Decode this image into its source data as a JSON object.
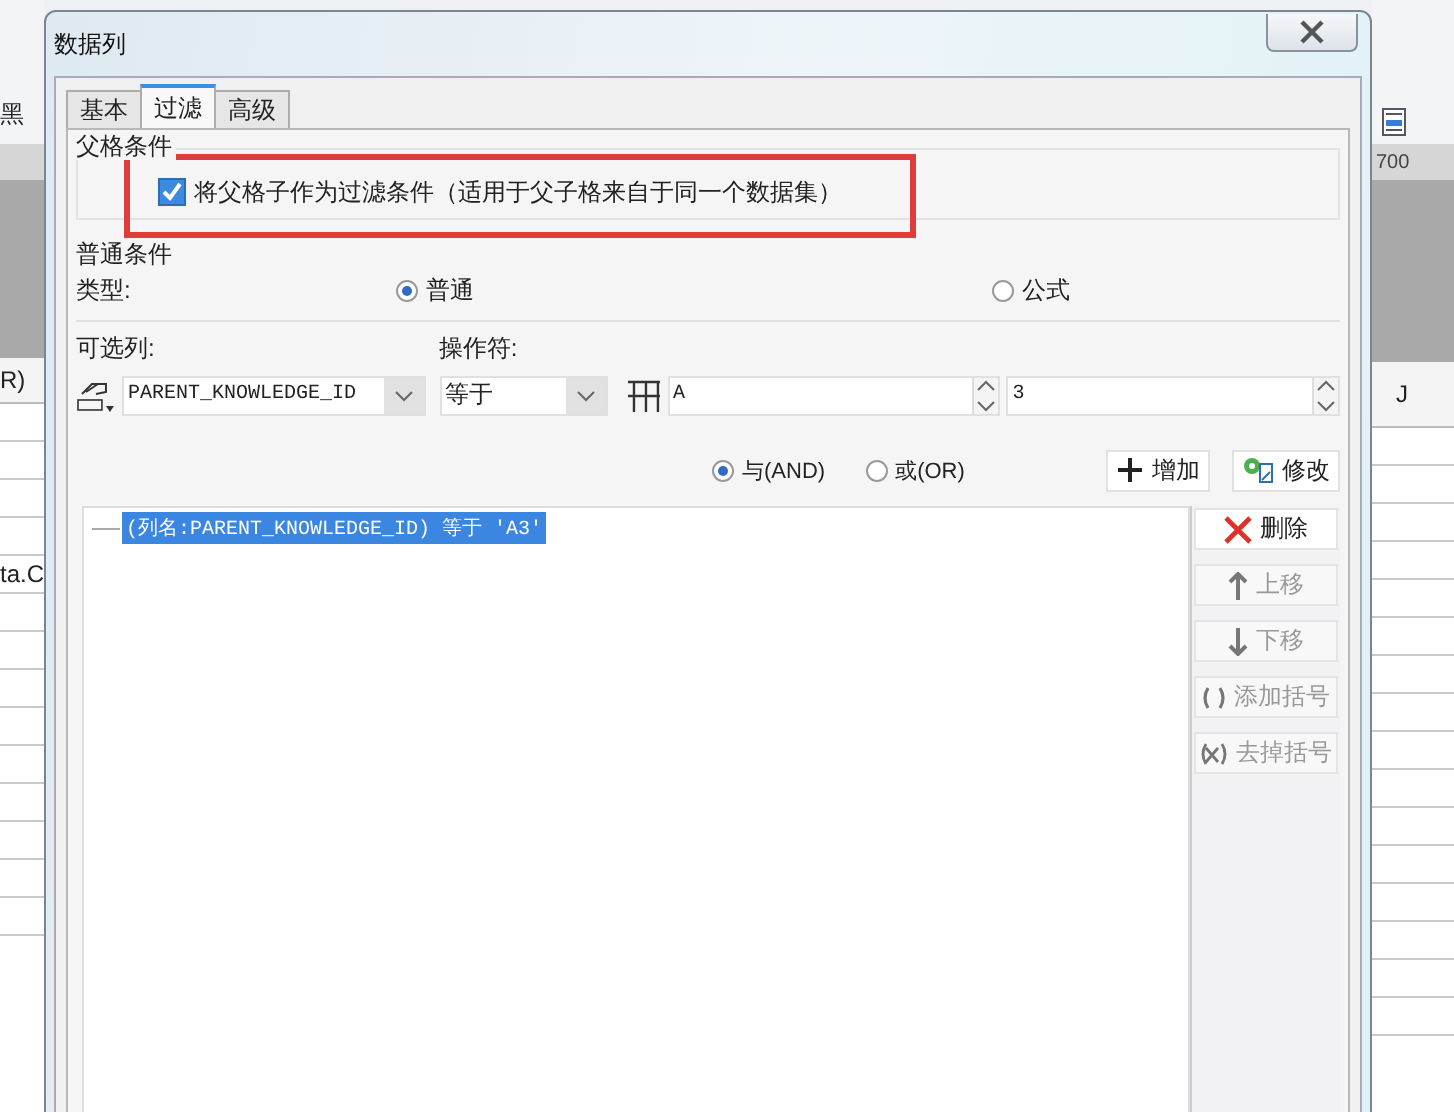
{
  "background": {
    "left_texts": [
      "黑",
      "R)",
      "ta.C"
    ],
    "right_texts": [
      "700",
      "J"
    ]
  },
  "dialog": {
    "title": "数据列"
  },
  "tabs": [
    {
      "label": "基本",
      "selected": false
    },
    {
      "label": "过滤",
      "selected": true
    },
    {
      "label": "高级",
      "selected": false
    }
  ],
  "parent_condition": {
    "label": "父格条件",
    "checkbox": {
      "label": "将父格子作为过滤条件（适用于父子格来自于同一个数据集）",
      "checked": true
    }
  },
  "normal_condition": {
    "label": "普通条件",
    "type_label": "类型:",
    "type_options": [
      {
        "label": "普通",
        "selected": true
      },
      {
        "label": "公式",
        "selected": false
      }
    ],
    "column_label": "可选列:",
    "operator_label": "操作符:",
    "column_value": "PARENT_KNOWLEDGE_ID",
    "operator_value": "等于",
    "value_1": "A",
    "value_2": "3"
  },
  "logic_options": [
    {
      "label": "与(AND)",
      "selected": true
    },
    {
      "label": "或(OR)",
      "selected": false
    }
  ],
  "action_buttons": [
    {
      "label": "增加",
      "kind": "add"
    },
    {
      "label": "修改",
      "kind": "edit"
    }
  ],
  "conditions": [
    {
      "text": "(列名:PARENT_KNOWLEDGE_ID) 等于 'A3'",
      "selected": true
    }
  ],
  "side_buttons": [
    {
      "label": "删除",
      "kind": "delete",
      "disabled": false
    },
    {
      "label": "上移",
      "kind": "up",
      "disabled": true
    },
    {
      "label": "下移",
      "kind": "down",
      "disabled": true
    },
    {
      "label": "添加括号",
      "kind": "add-bracket",
      "disabled": true
    },
    {
      "label": "去掉括号",
      "kind": "remove-bracket",
      "disabled": true
    }
  ]
}
